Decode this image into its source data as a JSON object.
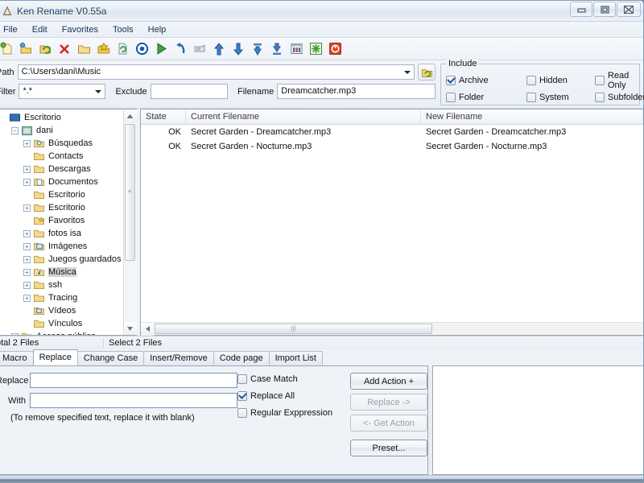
{
  "window": {
    "title": "Ken Rename V0.55a",
    "app_icon": "app-icon",
    "minimize_label": "Minimize",
    "maximize_label": "Maximize",
    "close_label": "Close"
  },
  "menubar": {
    "items": [
      {
        "label": "File"
      },
      {
        "label": "Edit"
      },
      {
        "label": "Favorites"
      },
      {
        "label": "Tools"
      },
      {
        "label": "Help"
      }
    ]
  },
  "toolbar": {
    "buttons": [
      {
        "name": "new-file-icon"
      },
      {
        "name": "open-folder-icon"
      },
      {
        "name": "refresh-folder-icon"
      },
      {
        "name": "delete-icon"
      },
      {
        "name": "folder-icon"
      },
      {
        "name": "favorite-star-icon"
      },
      {
        "name": "refresh-document-icon"
      },
      {
        "name": "target-circle-icon"
      },
      {
        "name": "run-play-icon"
      },
      {
        "name": "undo-icon"
      },
      {
        "name": "card-icon"
      },
      {
        "name": "move-up-icon"
      },
      {
        "name": "move-down-icon"
      },
      {
        "name": "move-top-icon"
      },
      {
        "name": "move-bottom-icon"
      },
      {
        "name": "columns-icon"
      },
      {
        "name": "sparkle-icon"
      },
      {
        "name": "exit-icon"
      }
    ]
  },
  "path_zone": {
    "path_label": "Path",
    "path_value": "C:\\Users\\dani\\Music",
    "browse_button": "browse-folder-icon",
    "filter_label": "Filter",
    "filter_value": "*.*",
    "exclude_label": "Exclude",
    "exclude_value": "",
    "filename_label": "Filename",
    "filename_value": "Dreamcatcher.mp3"
  },
  "include": {
    "legend": "Include",
    "options": [
      {
        "label": "Archive",
        "checked": true
      },
      {
        "label": "Hidden",
        "checked": false
      },
      {
        "label": "Read Only",
        "checked": false
      },
      {
        "label": "Folder",
        "checked": false
      },
      {
        "label": "System",
        "checked": false
      },
      {
        "label": "Subfolder",
        "checked": false
      }
    ]
  },
  "tree": {
    "nodes": [
      {
        "label": "Escritorio",
        "indent": 0,
        "expander": "none",
        "icon": "desktop-icon",
        "selected": false
      },
      {
        "label": "dani",
        "indent": 1,
        "expander": "collapse",
        "icon": "user-icon",
        "selected": false
      },
      {
        "label": "Búsquedas",
        "indent": 2,
        "expander": "expand",
        "icon": "search-folder-icon",
        "selected": false
      },
      {
        "label": "Contacts",
        "indent": 2,
        "expander": "none",
        "icon": "folder-icon",
        "selected": false
      },
      {
        "label": "Descargas",
        "indent": 2,
        "expander": "expand",
        "icon": "folder-icon",
        "selected": false
      },
      {
        "label": "Documentos",
        "indent": 2,
        "expander": "expand",
        "icon": "document-folder-icon",
        "selected": false
      },
      {
        "label": "Escritorio",
        "indent": 2,
        "expander": "none",
        "icon": "folder-icon",
        "selected": false
      },
      {
        "label": "Escritorio",
        "indent": 2,
        "expander": "expand",
        "icon": "folder-icon",
        "selected": false
      },
      {
        "label": "Favoritos",
        "indent": 2,
        "expander": "none",
        "icon": "favorites-folder-icon",
        "selected": false
      },
      {
        "label": "fotos isa",
        "indent": 2,
        "expander": "expand",
        "icon": "folder-icon",
        "selected": false
      },
      {
        "label": "Imágenes",
        "indent": 2,
        "expander": "expand",
        "icon": "pictures-folder-icon",
        "selected": false
      },
      {
        "label": "Juegos guardados",
        "indent": 2,
        "expander": "expand",
        "icon": "folder-icon",
        "selected": false
      },
      {
        "label": "Música",
        "indent": 2,
        "expander": "expand",
        "icon": "music-folder-icon",
        "selected": true
      },
      {
        "label": "ssh",
        "indent": 2,
        "expander": "expand",
        "icon": "folder-icon",
        "selected": false
      },
      {
        "label": "Tracing",
        "indent": 2,
        "expander": "expand",
        "icon": "folder-icon",
        "selected": false
      },
      {
        "label": "Vídeos",
        "indent": 2,
        "expander": "none",
        "icon": "videos-folder-icon",
        "selected": false
      },
      {
        "label": "Vínculos",
        "indent": 2,
        "expander": "none",
        "icon": "folder-icon",
        "selected": false
      },
      {
        "label": "Acceso público",
        "indent": 1,
        "expander": "expand",
        "icon": "folder-icon",
        "selected": false
      }
    ]
  },
  "file_list": {
    "columns": [
      "State",
      "Current Filename",
      "New Filename"
    ],
    "rows": [
      {
        "state": "OK",
        "current": "Secret Garden - Dreamcatcher.mp3",
        "new": "Secret Garden - Dreamcatcher.mp3"
      },
      {
        "state": "OK",
        "current": "Secret Garden - Nocturne.mp3",
        "new": "Secret Garden - Nocturne.mp3"
      }
    ]
  },
  "status": {
    "total": "otal 2 Files",
    "selected": "Select 2 Files"
  },
  "tabs": [
    {
      "label": "Macro",
      "active": false
    },
    {
      "label": "Replace",
      "active": true
    },
    {
      "label": "Change Case",
      "active": false
    },
    {
      "label": "Insert/Remove",
      "active": false
    },
    {
      "label": "Code page",
      "active": false
    },
    {
      "label": "Import List",
      "active": false
    }
  ],
  "replace_tab": {
    "replace_label": "Replace",
    "replace_value": "",
    "with_label": "With",
    "with_value": "",
    "hint": "(To remove specified text, replace it with blank)",
    "options": [
      {
        "label": "Case Match",
        "checked": false
      },
      {
        "label": "Replace All",
        "checked": true
      },
      {
        "label": "Regular Exppression",
        "checked": false
      }
    ],
    "buttons": [
      {
        "label": "Add Action +",
        "disabled": false
      },
      {
        "label": "Replace ->",
        "disabled": true
      },
      {
        "label": "<- Get Action",
        "disabled": true
      },
      {
        "label": "Preset...",
        "disabled": false
      }
    ]
  },
  "colors": {
    "accent": "#21559c",
    "title_text": "#1c3e63",
    "selection": "#d4d4d4"
  }
}
